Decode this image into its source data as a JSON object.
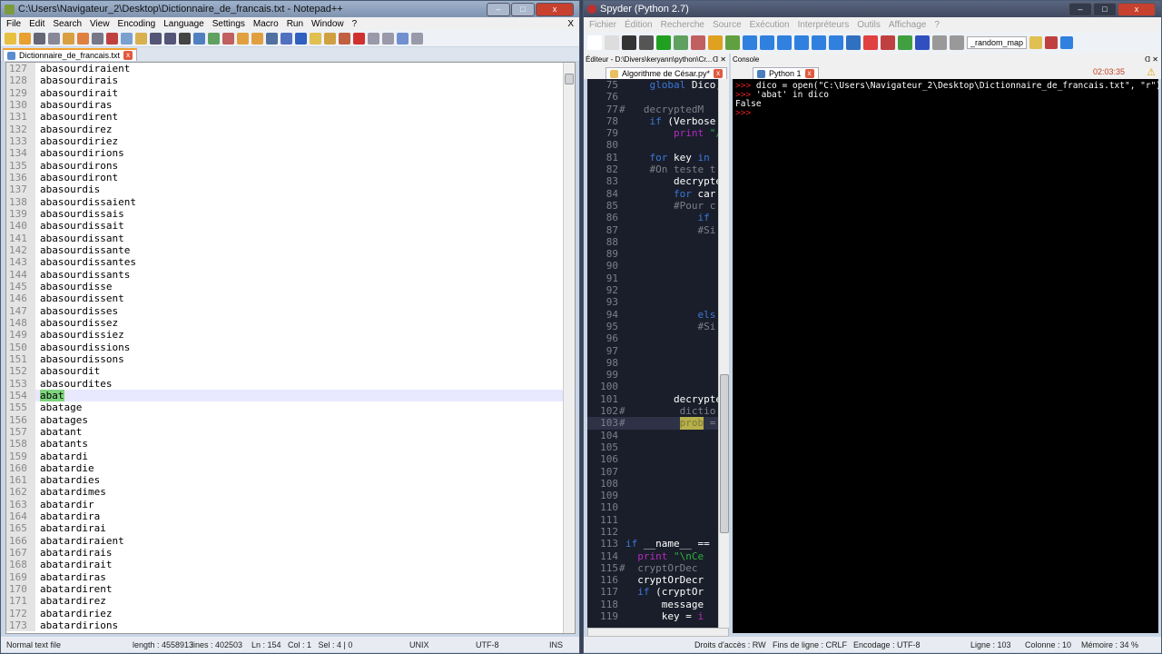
{
  "notepad": {
    "title": "C:\\Users\\Navigateur_2\\Desktop\\Dictionnaire_de_francais.txt - Notepad++",
    "menu": [
      "File",
      "Edit",
      "Search",
      "View",
      "Encoding",
      "Language",
      "Settings",
      "Macro",
      "Run",
      "Window",
      "?"
    ],
    "menu_close": "X",
    "tab": "Dictionnaire_de_francais.txt",
    "lines": [
      {
        "n": "127",
        "t": "abasourdiraient"
      },
      {
        "n": "128",
        "t": "abasourdirais"
      },
      {
        "n": "129",
        "t": "abasourdirait"
      },
      {
        "n": "130",
        "t": "abasourdiras"
      },
      {
        "n": "131",
        "t": "abasourdirent"
      },
      {
        "n": "132",
        "t": "abasourdirez"
      },
      {
        "n": "133",
        "t": "abasourdiriez"
      },
      {
        "n": "134",
        "t": "abasourdirions"
      },
      {
        "n": "135",
        "t": "abasourdirons"
      },
      {
        "n": "136",
        "t": "abasourdiront"
      },
      {
        "n": "137",
        "t": "abasourdis"
      },
      {
        "n": "138",
        "t": "abasourdissaient"
      },
      {
        "n": "139",
        "t": "abasourdissais"
      },
      {
        "n": "140",
        "t": "abasourdissait"
      },
      {
        "n": "141",
        "t": "abasourdissant"
      },
      {
        "n": "142",
        "t": "abasourdissante"
      },
      {
        "n": "143",
        "t": "abasourdissantes"
      },
      {
        "n": "144",
        "t": "abasourdissants"
      },
      {
        "n": "145",
        "t": "abasourdisse"
      },
      {
        "n": "146",
        "t": "abasourdissent"
      },
      {
        "n": "147",
        "t": "abasourdisses"
      },
      {
        "n": "148",
        "t": "abasourdissez"
      },
      {
        "n": "149",
        "t": "abasourdissiez"
      },
      {
        "n": "150",
        "t": "abasourdissions"
      },
      {
        "n": "151",
        "t": "abasourdissons"
      },
      {
        "n": "152",
        "t": "abasourdit"
      },
      {
        "n": "153",
        "t": "abasourdites"
      },
      {
        "n": "154",
        "t": "abat",
        "current": true
      },
      {
        "n": "155",
        "t": "abatage"
      },
      {
        "n": "156",
        "t": "abatages"
      },
      {
        "n": "157",
        "t": "abatant"
      },
      {
        "n": "158",
        "t": "abatants"
      },
      {
        "n": "159",
        "t": "abatardi"
      },
      {
        "n": "160",
        "t": "abatardie"
      },
      {
        "n": "161",
        "t": "abatardies"
      },
      {
        "n": "162",
        "t": "abatardimes"
      },
      {
        "n": "163",
        "t": "abatardir"
      },
      {
        "n": "164",
        "t": "abatardira"
      },
      {
        "n": "165",
        "t": "abatardirai"
      },
      {
        "n": "166",
        "t": "abatardiraient"
      },
      {
        "n": "167",
        "t": "abatardirais"
      },
      {
        "n": "168",
        "t": "abatardirait"
      },
      {
        "n": "169",
        "t": "abatardiras"
      },
      {
        "n": "170",
        "t": "abatardirent"
      },
      {
        "n": "171",
        "t": "abatardirez"
      },
      {
        "n": "172",
        "t": "abatardiriez"
      },
      {
        "n": "173",
        "t": "abatardirions"
      }
    ],
    "status": {
      "type": "Normal text file",
      "length": "length : 4558913",
      "lines": "lines : 402503",
      "pos": "Ln : 154   Col : 1   Sel : 4 | 0",
      "eol": "UNIX",
      "encoding": "UTF-8",
      "mode": "INS"
    }
  },
  "spyder": {
    "title": "Spyder (Python 2.7)",
    "menu": [
      "Fichier",
      "Édition",
      "Recherche",
      "Source",
      "Exécution",
      "Interpréteurs",
      "Outils",
      "Affichage",
      "?"
    ],
    "toolbar_combo": "_random_map",
    "editor_pane": "Éditeur - D:\\Divers\\keryann\\python\\Cr...",
    "console_pane": "Console",
    "editor_tab": "Algorithme de César.py*",
    "console_tab": "Python 1",
    "console_time": "02:03:35",
    "code": [
      {
        "n": "75",
        "m": "",
        "s": [
          [
            "kw",
            "    global"
          ],
          [
            "pl",
            " Dico,"
          ]
        ]
      },
      {
        "n": "76",
        "m": "",
        "s": []
      },
      {
        "n": "77",
        "m": "#",
        "s": [
          [
            "cm",
            "   decryptedM"
          ]
        ]
      },
      {
        "n": "78",
        "m": "",
        "s": [
          [
            "kw",
            "    if"
          ],
          [
            "pl",
            " (Verbose"
          ]
        ]
      },
      {
        "n": "79",
        "m": "",
        "s": [
          [
            "pr",
            "        print"
          ],
          [
            "st",
            " \"/"
          ]
        ]
      },
      {
        "n": "80",
        "m": "",
        "s": []
      },
      {
        "n": "81",
        "m": "",
        "s": [
          [
            "kw",
            "    for"
          ],
          [
            "pl",
            " key "
          ],
          [
            "kw",
            "in"
          ]
        ]
      },
      {
        "n": "82",
        "m": "",
        "s": [
          [
            "cm",
            "    #On teste t"
          ]
        ]
      },
      {
        "n": "83",
        "m": "",
        "s": [
          [
            "pl",
            "        decrypte"
          ]
        ]
      },
      {
        "n": "84",
        "m": "",
        "s": [
          [
            "kw",
            "        for"
          ],
          [
            "pl",
            " car"
          ]
        ]
      },
      {
        "n": "85",
        "m": "",
        "s": [
          [
            "cm",
            "        #Pour c"
          ]
        ]
      },
      {
        "n": "86",
        "m": "",
        "s": [
          [
            "kw",
            "            if"
          ]
        ]
      },
      {
        "n": "87",
        "m": "",
        "s": [
          [
            "cm",
            "            #Si"
          ]
        ]
      },
      {
        "n": "88",
        "m": "",
        "s": []
      },
      {
        "n": "89",
        "m": "",
        "s": []
      },
      {
        "n": "90",
        "m": "",
        "s": []
      },
      {
        "n": "91",
        "m": "",
        "s": []
      },
      {
        "n": "92",
        "m": "",
        "s": []
      },
      {
        "n": "93",
        "m": "",
        "s": []
      },
      {
        "n": "94",
        "m": "",
        "s": [
          [
            "kw",
            "            els"
          ]
        ]
      },
      {
        "n": "95",
        "m": "",
        "s": [
          [
            "cm",
            "            #Si"
          ]
        ]
      },
      {
        "n": "96",
        "m": "",
        "s": []
      },
      {
        "n": "97",
        "m": "",
        "s": []
      },
      {
        "n": "98",
        "m": "",
        "s": []
      },
      {
        "n": "99",
        "m": "",
        "s": []
      },
      {
        "n": "100",
        "m": "",
        "s": []
      },
      {
        "n": "101",
        "m": "",
        "s": [
          [
            "pl",
            "        decrypte"
          ]
        ]
      },
      {
        "n": "102",
        "m": "#",
        "s": [
          [
            "cm",
            "         dictio"
          ]
        ]
      },
      {
        "n": "103",
        "m": "#",
        "s": [
          [
            "cm",
            "         "
          ],
          [
            "hl",
            "prob"
          ],
          [
            "cm",
            " ="
          ]
        ],
        "current": true
      },
      {
        "n": "104",
        "m": "",
        "s": []
      },
      {
        "n": "105",
        "m": "",
        "s": []
      },
      {
        "n": "106",
        "m": "",
        "s": []
      },
      {
        "n": "107",
        "m": "",
        "s": []
      },
      {
        "n": "108",
        "m": "",
        "s": []
      },
      {
        "n": "109",
        "m": "",
        "s": []
      },
      {
        "n": "110",
        "m": "",
        "s": []
      },
      {
        "n": "111",
        "m": "",
        "s": []
      },
      {
        "n": "112",
        "m": "",
        "s": []
      },
      {
        "n": "113",
        "m": "",
        "s": [
          [
            "kw",
            "if"
          ],
          [
            "pl",
            " __name__ =="
          ]
        ]
      },
      {
        "n": "114",
        "m": "",
        "s": [
          [
            "pr",
            "  print"
          ],
          [
            "st",
            " \"\\nCe"
          ]
        ]
      },
      {
        "n": "115",
        "m": "#",
        "s": [
          [
            "cm",
            "  cryptOrDec"
          ]
        ]
      },
      {
        "n": "116",
        "m": "",
        "s": [
          [
            "pl",
            "  cryptOrDecr"
          ]
        ]
      },
      {
        "n": "117",
        "m": "",
        "s": [
          [
            "kw",
            "  if"
          ],
          [
            "pl",
            " (cryptOr"
          ]
        ]
      },
      {
        "n": "118",
        "m": "",
        "s": [
          [
            "pl",
            "      message"
          ]
        ]
      },
      {
        "n": "119",
        "m": "",
        "s": [
          [
            "pl",
            "      key = "
          ],
          [
            "pr",
            "i"
          ]
        ]
      }
    ],
    "console_lines": [
      {
        "prompt": ">>> ",
        "text": "dico = open(\"C:\\Users\\Navigateur_2\\Desktop\\Dictionnaire_de_francais.txt\", \"r\")"
      },
      {
        "prompt": ">>> ",
        "text": "'abat' in dico"
      },
      {
        "prompt": "",
        "text": "False"
      },
      {
        "prompt": ">>> ",
        "text": ""
      }
    ],
    "status": {
      "access": "Droits d'accès : RW",
      "eol": "Fins de ligne : CRLF",
      "encoding": "Encodage : UTF-8",
      "line": "Ligne : 103",
      "col": "Colonne : 10",
      "mem": "Mémoire : 34 %"
    }
  }
}
